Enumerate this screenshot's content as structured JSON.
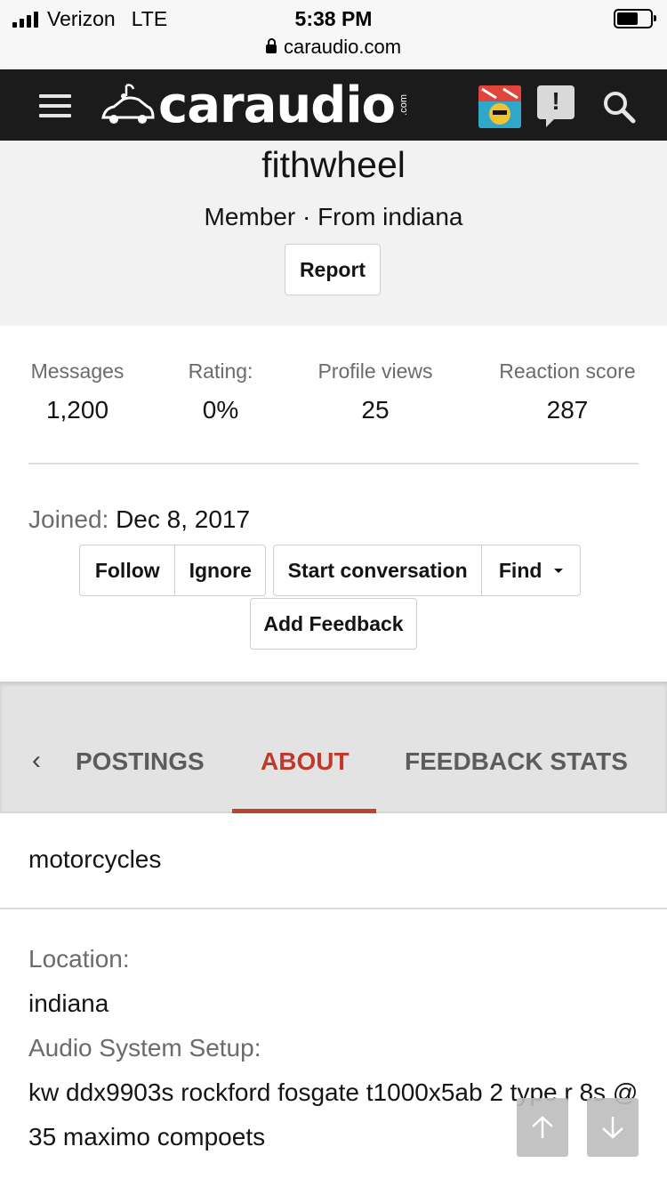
{
  "status_bar": {
    "carrier": "Verizon",
    "network": "LTE",
    "time": "5:38 PM",
    "url": "caraudio.com",
    "battery_level": 0.65
  },
  "navbar": {
    "logo_text": "caraudio",
    "logo_suffix": ".com",
    "avatar_icon": "stay-cool-avatar-icon",
    "alert_icon": "alert-icon",
    "search_icon": "search-icon",
    "menu_icon": "hamburger-menu-icon"
  },
  "profile": {
    "username": "fithwheel",
    "member_line": "Member · From indiana",
    "report_label": "Report"
  },
  "stats": [
    {
      "label": "Messages",
      "value": "1,200"
    },
    {
      "label": "Rating:",
      "value": "0%"
    },
    {
      "label": "Profile views",
      "value": "25"
    },
    {
      "label": "Reaction score",
      "value": "287"
    }
  ],
  "joined": {
    "label": "Joined:",
    "value": "Dec 8, 2017"
  },
  "actions": {
    "follow": "Follow",
    "ignore": "Ignore",
    "start_conversation": "Start conversation",
    "find": "Find",
    "add_feedback": "Add Feedback"
  },
  "tabs": {
    "prev_icon": "chevron-left-icon",
    "items": [
      "POSTINGS",
      "ABOUT",
      "FEEDBACK STATS"
    ],
    "active": "ABOUT"
  },
  "about": {
    "text": "motorcycles",
    "location_label": "Location:",
    "location_value": "indiana",
    "setup_label": "Audio System Setup:",
    "setup_value": "kw ddx9903s rockford fosgate t1000x5ab 2 type r 8s @ 35 maximo compoets"
  },
  "colors": {
    "navbar": "#1b1b1b",
    "accent": "#c0432e",
    "header_bg": "#f2f2f2"
  }
}
